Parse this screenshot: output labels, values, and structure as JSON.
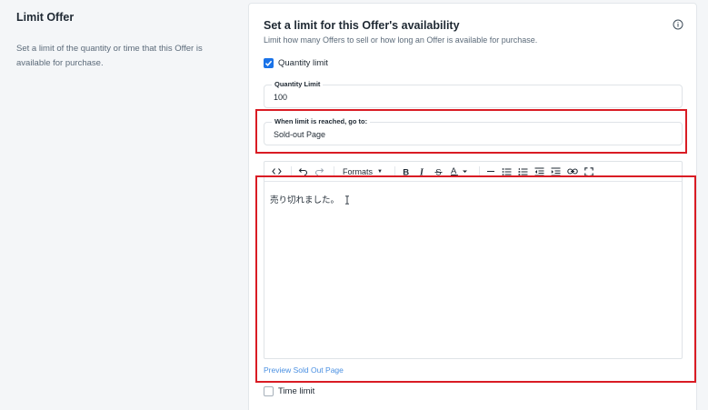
{
  "left": {
    "title": "Limit Offer",
    "description": "Set a limit of the quantity or time that this Offer is available for purchase."
  },
  "card": {
    "title": "Set a limit for this Offer's availability",
    "subtitle": "Limit how many Offers to sell or how long an Offer is available for purchase.",
    "info_icon": "info-circle-icon",
    "quantity_limit": {
      "label": "Quantity limit",
      "checked": true
    },
    "quantity_field": {
      "legend": "Quantity Limit",
      "value": "100"
    },
    "redirect_field": {
      "legend": "When limit is reached, go to:",
      "value": "Sold-out Page"
    },
    "editor": {
      "toolbar": {
        "code": "code-icon",
        "undo": "undo-icon",
        "redo": "redo-icon",
        "formats_label": "Formats",
        "bold": "bold-icon",
        "italic": "italic-icon",
        "strike": "strikethrough-icon",
        "text_color": "text-color-icon",
        "hr": "horizontal-rule-icon",
        "bullet_list": "bullet-list-icon",
        "numbered_list": "numbered-list-icon",
        "outdent": "outdent-icon",
        "indent": "indent-icon",
        "link": "link-icon",
        "fullscreen": "fullscreen-icon"
      },
      "content": "売り切れました。"
    },
    "preview_link": "Preview Sold Out Page",
    "time_limit": {
      "label": "Time limit",
      "checked": false
    }
  },
  "colors": {
    "accent": "#1a73e8",
    "highlight": "#d91c24",
    "link": "#4a90e2"
  }
}
